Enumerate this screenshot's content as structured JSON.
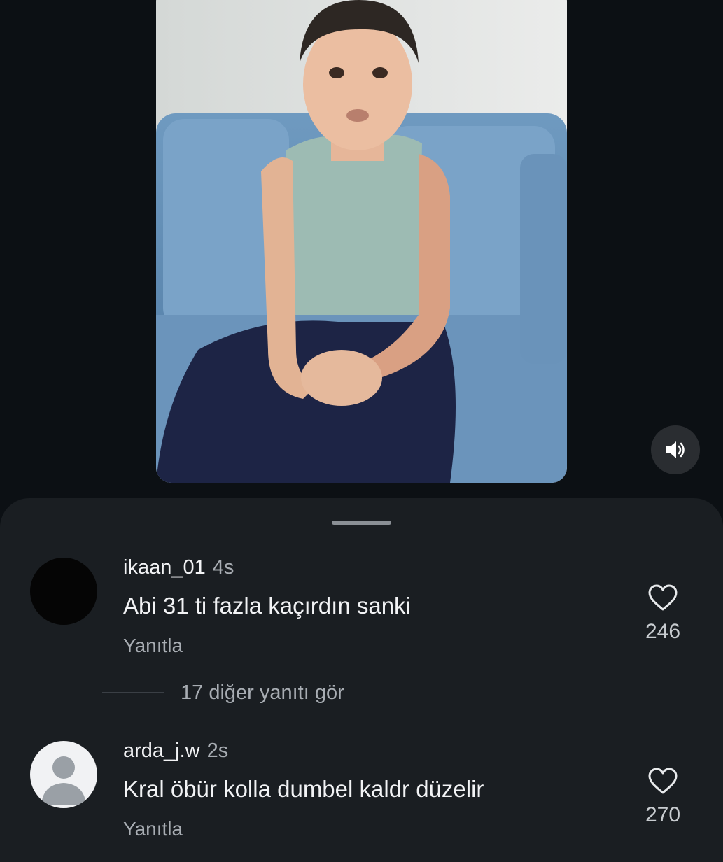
{
  "video": {
    "mute_icon": "speaker-icon"
  },
  "comments": [
    {
      "username": "ikaan_01",
      "time": "4s",
      "text": "Abi 31 ti fazla kaçırdın sanki",
      "reply_label": "Yanıtla",
      "likes": "246"
    },
    {
      "username": "arda_j.w",
      "time": "2s",
      "text": "Kral öbür kolla dumbel kaldr düzelir",
      "reply_label": "Yanıtla",
      "likes": "270"
    }
  ],
  "more_replies": "17 diğer yanıtı gör",
  "colors": {
    "background": "#0c1014",
    "sheet": "#1a1e22",
    "text": "#f2f3f5",
    "muted": "#a8adb3"
  }
}
